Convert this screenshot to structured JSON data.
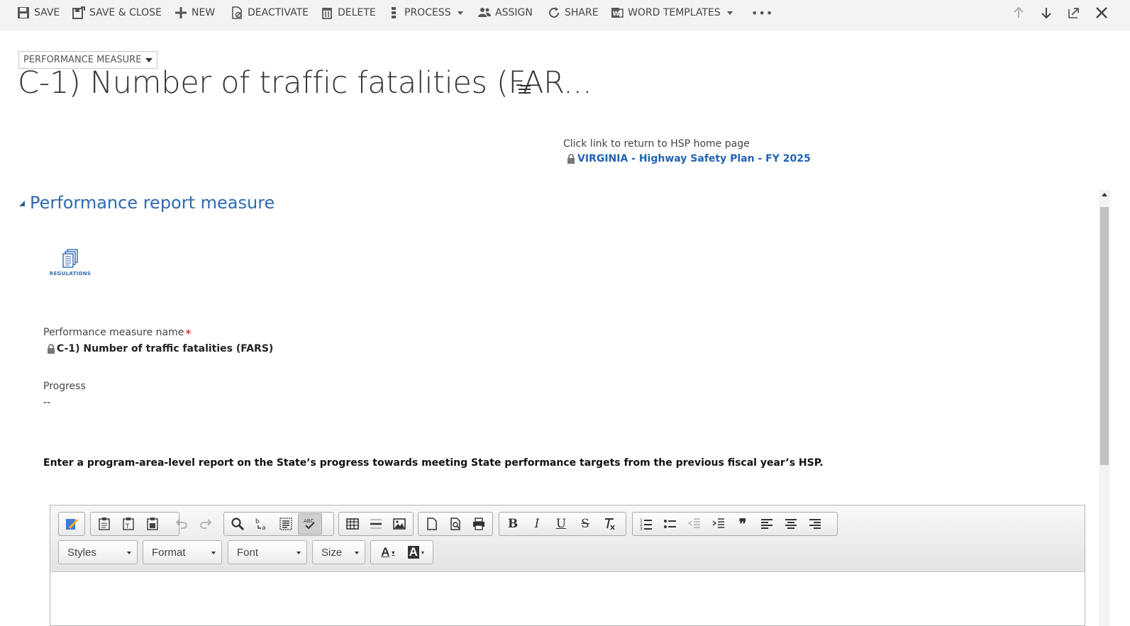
{
  "command_bar": {
    "save": "SAVE",
    "save_close": "SAVE & CLOSE",
    "new": "NEW",
    "deactivate": "DEACTIVATE",
    "delete": "DELETE",
    "process": "PROCESS",
    "assign": "ASSIGN",
    "share": "SHARE",
    "word_templates": "WORD TEMPLATES",
    "more": "•••"
  },
  "header": {
    "entity_selector": "PERFORMANCE MEASURE",
    "title": "C-1) Number of traffic fatalities (FAR..."
  },
  "hsp": {
    "caption": "Click link to return to HSP home page",
    "link": "VIRGINIA - Highway Safety Plan - FY 2025"
  },
  "section": {
    "title": "Performance report measure",
    "regulations_label": "REGULATIONS"
  },
  "fields": {
    "name_label": "Performance measure name",
    "name_required": "*",
    "name_value": "C-1) Number of traffic fatalities (FARS)",
    "progress_label": "Progress",
    "progress_value": "--"
  },
  "instruction": "Enter a program-area-level report on the State’s progress towards meeting State performance targets from the previous fiscal year’s HSP.",
  "editor": {
    "styles": "Styles",
    "format": "Format",
    "font": "Font",
    "size": "Size",
    "bold": "B",
    "italic": "I",
    "underline": "U",
    "strike": "S",
    "quote": "❞",
    "text_color": "A",
    "bg_color": "A"
  },
  "colors": {
    "accent": "#2e6ab1",
    "link": "#1f64b4",
    "required": "#cc0000"
  }
}
